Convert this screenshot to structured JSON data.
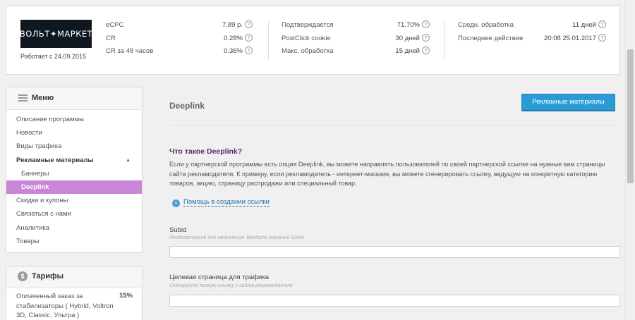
{
  "stats": {
    "logo": "ВОЛЬТ✦МАРКЕТ",
    "since": "Работает с 24.09.2015",
    "col1": [
      {
        "label": "eCPC",
        "value": "7.89 р."
      },
      {
        "label": "CR",
        "value": "0.28%"
      },
      {
        "label": "CR за 48 часов",
        "value": "0.36%"
      }
    ],
    "col2": [
      {
        "label": "Подтверждается",
        "value": "71.70%"
      },
      {
        "label": "PostClick cookie",
        "value": "30 дней"
      },
      {
        "label": "Макс. обработка",
        "value": "15 дней"
      }
    ],
    "col3": [
      {
        "label": "Средн. обработка",
        "value": "11 дней"
      },
      {
        "label": "Последнее действие",
        "value": "20:08 25.01.2017"
      }
    ],
    "help_glyph": "?"
  },
  "menu": {
    "title": "Меню",
    "items": [
      {
        "label": "Описание программы"
      },
      {
        "label": "Новости"
      },
      {
        "label": "Виды трафика"
      },
      {
        "label": "Рекламные материалы"
      },
      {
        "label": "Баннеры"
      },
      {
        "label": "Deeplink"
      },
      {
        "label": "Скидки и купоны"
      },
      {
        "label": "Связаться с нами"
      },
      {
        "label": "Аналитика"
      },
      {
        "label": "Товары"
      }
    ],
    "caret": "▲"
  },
  "tariffs": {
    "title": "Тарифы",
    "coin": "$",
    "item_name": "Оплаченный заказ за стабилизаторы ( Hybrid, Voltron 3D, Classic, Ультра )",
    "item_pct": "15%"
  },
  "main": {
    "page_title": "Deeplink",
    "button_label": "Рекламные материалы",
    "section_title": "Что такое Deeplink?",
    "description": "Если у партнерской программы есть опция Deeplink, вы можете направлять пользователей по своей партнерской ссылке на нужные вам страницы сайта рекламодателя. К примеру, если рекламодатель - интернет-магазин, вы можете сгенерировать ссылку, ведущую на конкретную категорию товаров, акцию, страницу распродажи или специальный товар.",
    "help_link": "Помощь в создании ссылки",
    "help_icon": "»",
    "fields": [
      {
        "label": "Subid",
        "hint": "Необязательно для заполнения. Введите значение Subid.",
        "value": ""
      },
      {
        "label": "Целевая страница для трафика",
        "hint": "Скопируйте полную ссылку с сайта рекламодателя",
        "value": ""
      }
    ]
  },
  "colors": {
    "accent": "#2a9bd5",
    "active_menu": "#c986d6",
    "section_title": "#5b2670",
    "link": "#1f6fa8"
  }
}
